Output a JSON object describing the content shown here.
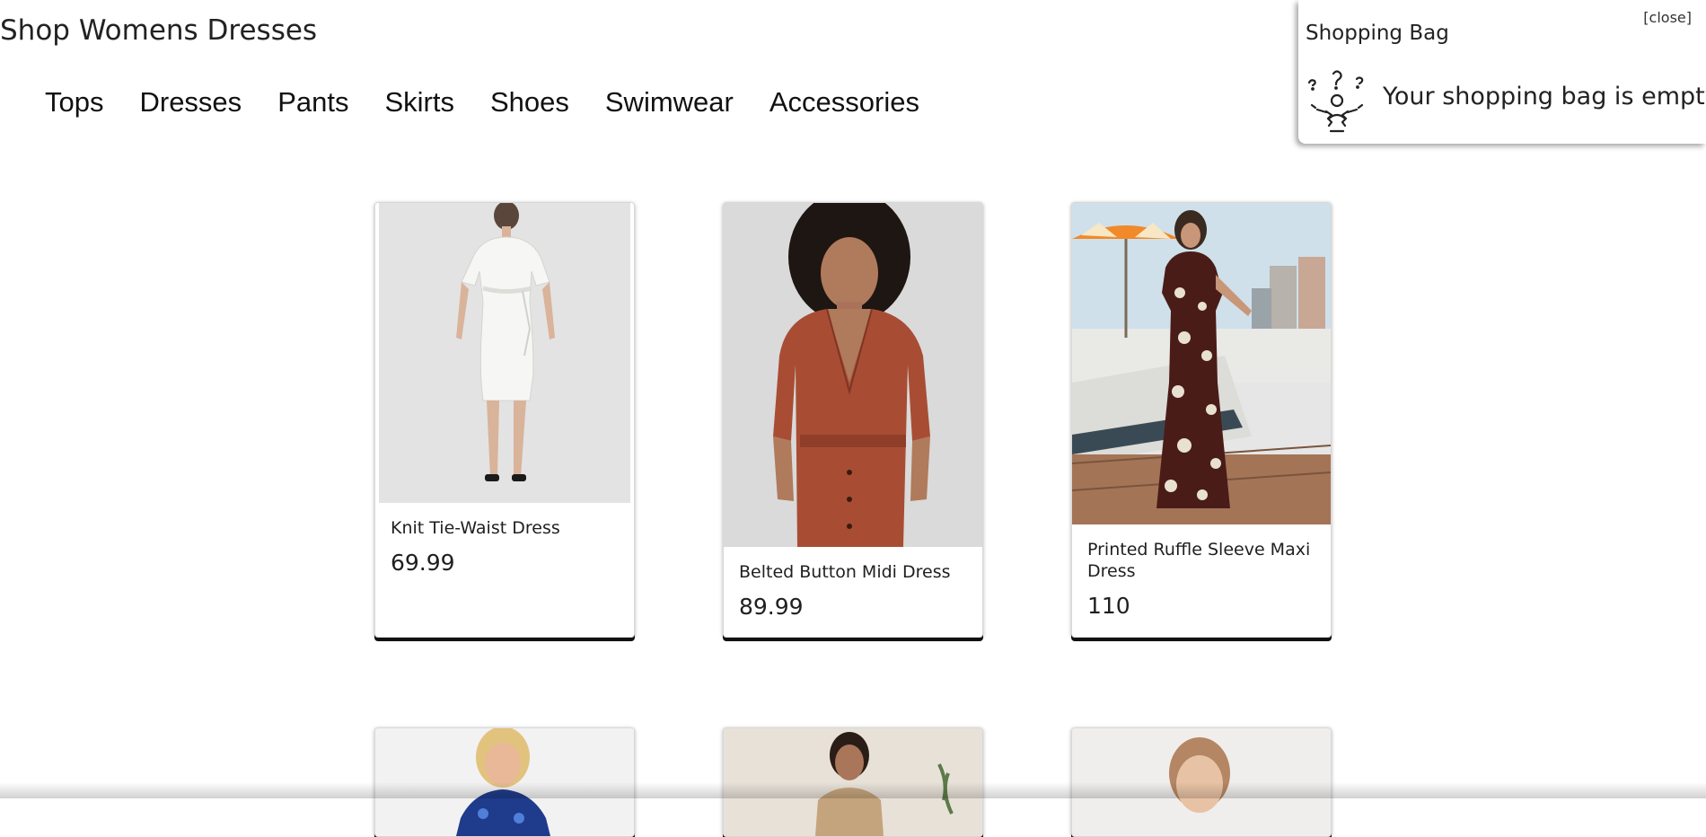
{
  "page": {
    "title": "Shop Womens Dresses"
  },
  "nav": {
    "items": [
      {
        "label": "Tops"
      },
      {
        "label": "Dresses"
      },
      {
        "label": "Pants"
      },
      {
        "label": "Skirts"
      },
      {
        "label": "Shoes"
      },
      {
        "label": "Swimwear"
      },
      {
        "label": "Accessories"
      }
    ]
  },
  "bag": {
    "title": "Shopping Bag",
    "close_label": "[close]",
    "empty_message": "Your shopping bag is empty!",
    "icon": "confused-person-icon"
  },
  "products": [
    {
      "name": "Knit Tie-Waist Dress",
      "price": "69.99",
      "image": "white-dress-photo"
    },
    {
      "name": "Belted Button Midi Dress",
      "price": "89.99",
      "image": "rust-dress-photo"
    },
    {
      "name": "Printed Ruffle Sleeve Maxi Dress",
      "price": "110",
      "image": "floral-maxi-dress-photo"
    },
    {
      "image": "blue-dress-photo"
    },
    {
      "image": "beige-dress-photo"
    },
    {
      "image": "blonde-model-photo"
    }
  ]
}
